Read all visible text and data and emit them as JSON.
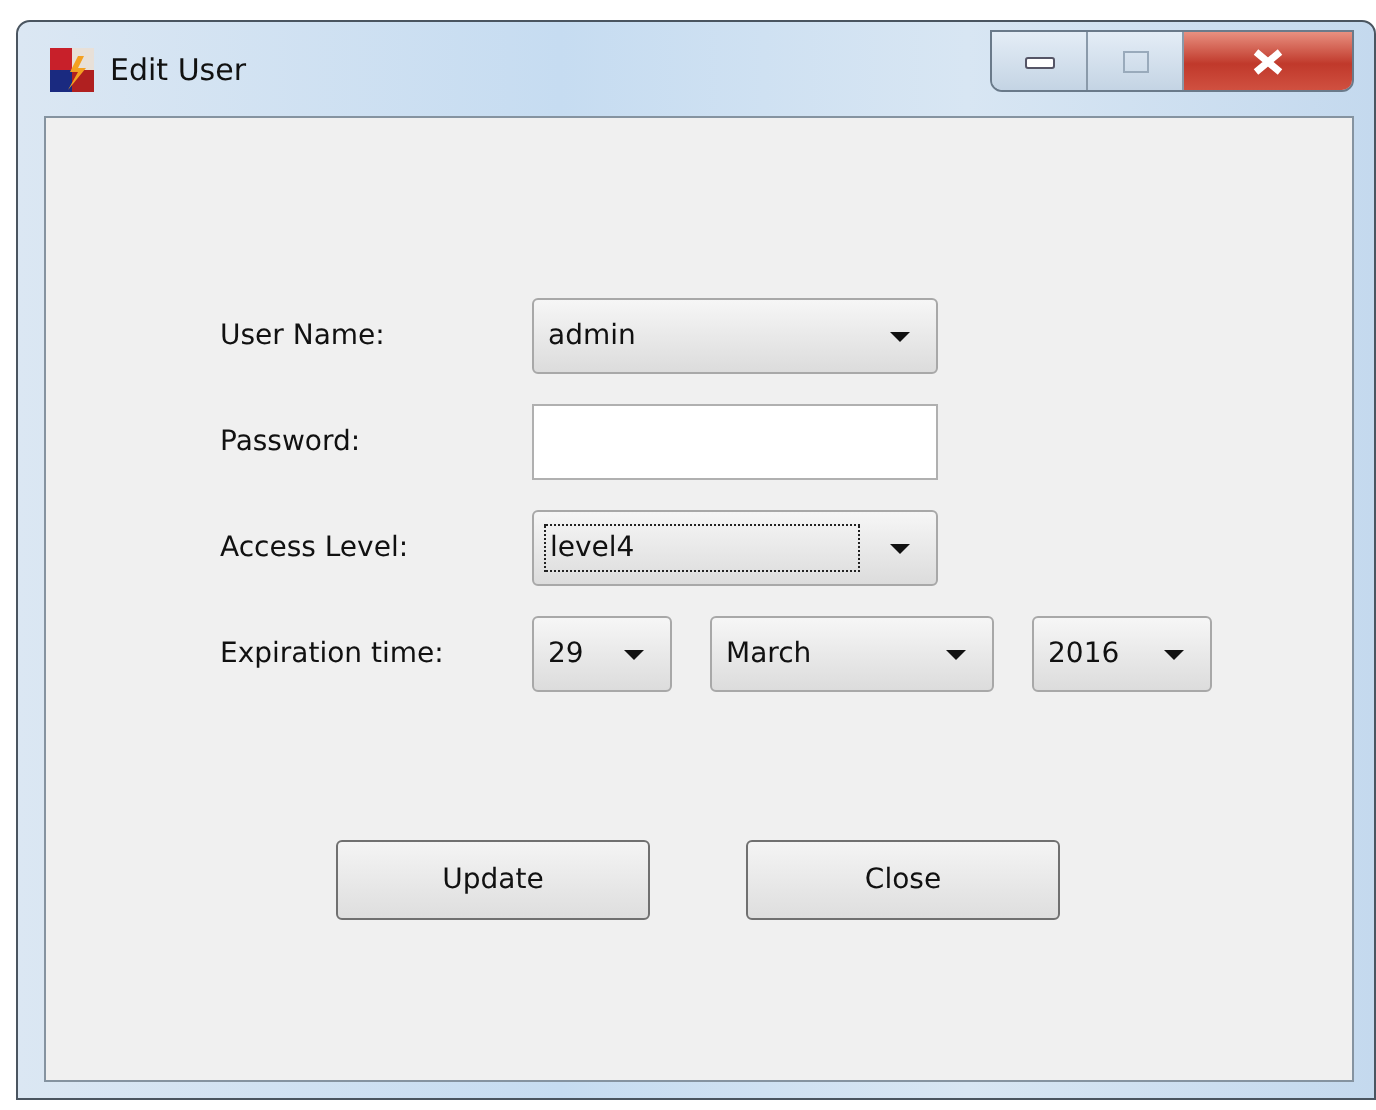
{
  "window": {
    "title": "Edit User"
  },
  "fields": [
    {
      "label": "User Name:",
      "kind": "combo",
      "value": "admin",
      "focused": false
    },
    {
      "label": "Password:",
      "kind": "text"
    },
    {
      "label": "Access Level:",
      "kind": "combo",
      "value": "level4",
      "focused": true
    },
    {
      "label": "Expiration time:",
      "kind": "date",
      "parts": [
        "29",
        "March",
        "2016"
      ]
    }
  ],
  "buttons": [
    "Update",
    "Close"
  ]
}
